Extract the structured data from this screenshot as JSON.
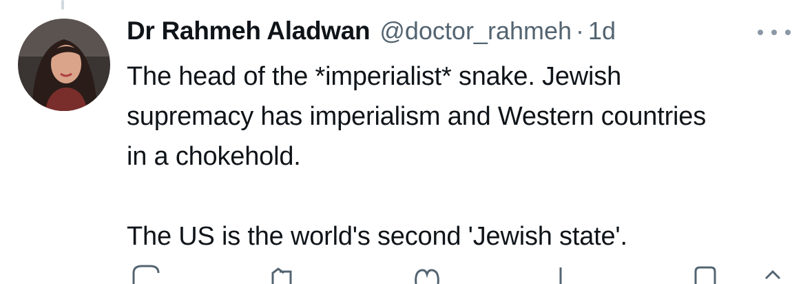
{
  "author": {
    "display_name": "Dr Rahmeh Aladwan",
    "handle": "@doctor_rahmeh",
    "separator": "·",
    "timestamp": "1d"
  },
  "tweet": {
    "lines": [
      "The head of the *imperialist* snake. Jewish supremacy has imperialism and Western countries in a chokehold.",
      "The US is the world's second 'Jewish state'."
    ]
  },
  "icons": {
    "more": "more-horizontal-icon",
    "reply": "reply-icon",
    "retweet": "retweet-icon",
    "like": "heart-icon",
    "views": "views-icon",
    "bookmark": "bookmark-icon",
    "share": "share-icon"
  },
  "colors": {
    "text_primary": "#0f1419",
    "text_secondary": "#536471",
    "thread_line": "#cfd9de"
  }
}
